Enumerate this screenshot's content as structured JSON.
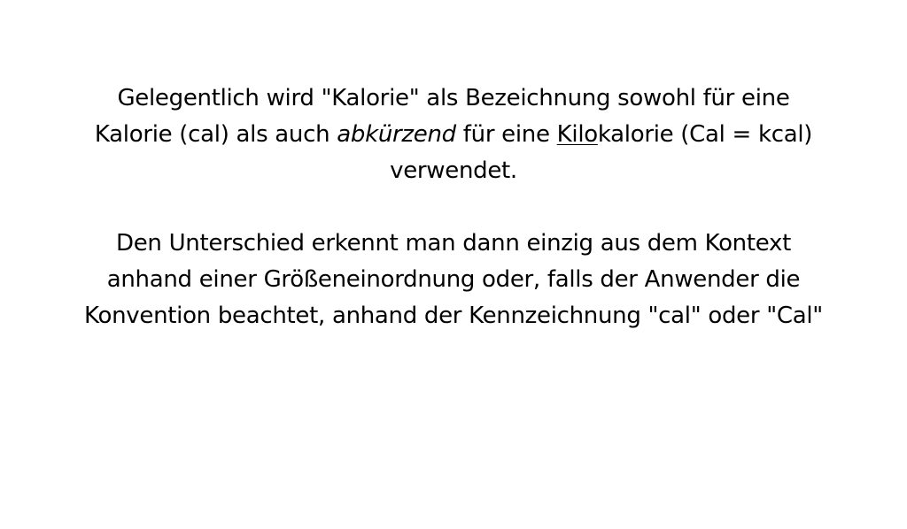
{
  "paragraph1": {
    "line1": "Gelegentlich wird \"Kalorie\" als Bezeichnung sowohl für eine",
    "line2_a": "Kalorie (cal) als auch ",
    "line2_italic": "abkürzend",
    "line2_b": " für eine ",
    "line2_underline": "Kilo",
    "line2_c": "kalorie (Cal = kcal)",
    "line3": "verwendet."
  },
  "paragraph2": {
    "line1": "Den Unterschied erkennt man dann einzig aus dem Kontext",
    "line2": "anhand einer Größeneinordnung oder, falls der Anwender die",
    "line3": "Konvention beachtet, anhand der Kennzeichnung \"cal\" oder \"Cal\""
  }
}
